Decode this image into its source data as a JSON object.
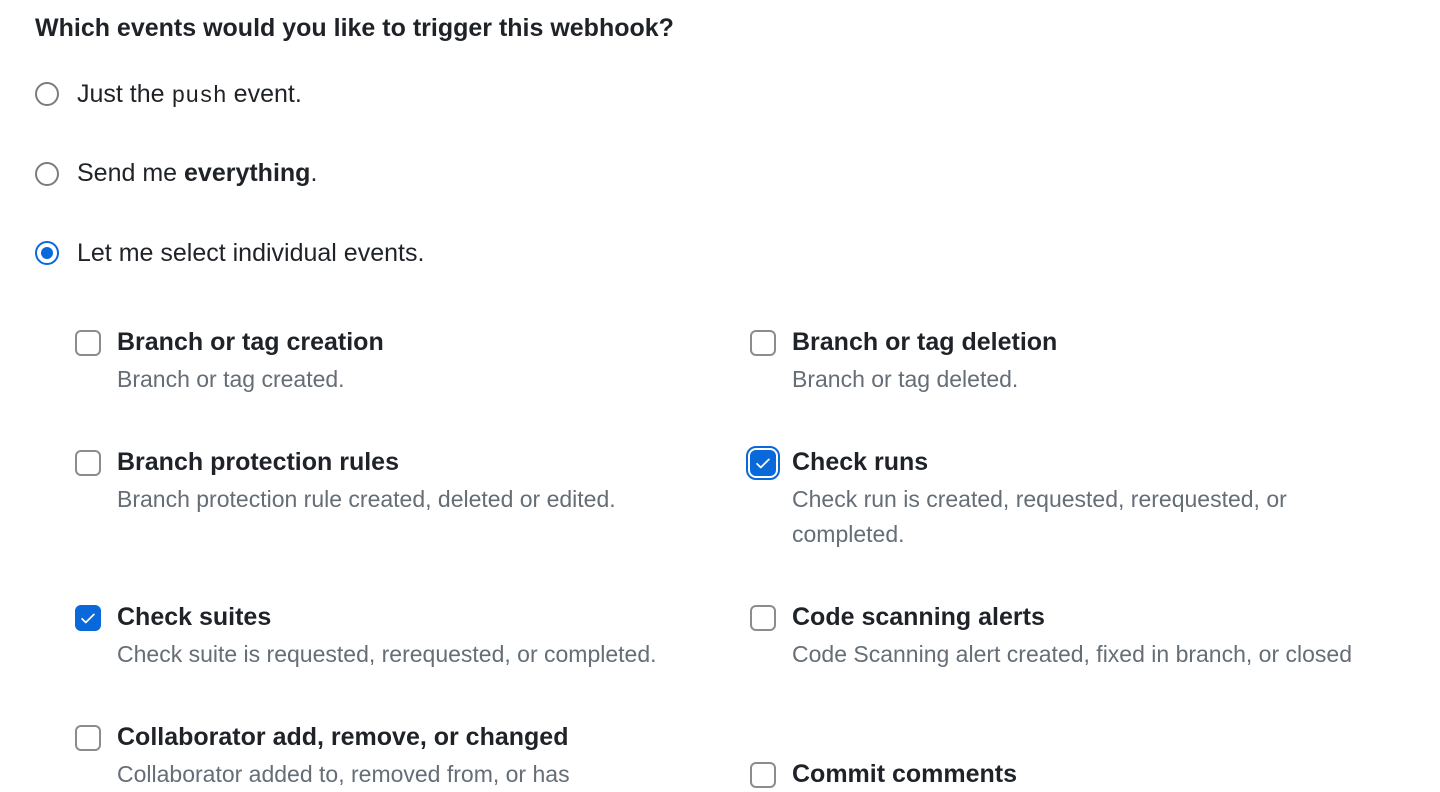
{
  "heading": "Which events would you like to trigger this webhook?",
  "radios": {
    "push": {
      "prefix": "Just the ",
      "code": "push",
      "suffix": " event.",
      "checked": false
    },
    "everything": {
      "prefix": "Send me ",
      "bold": "everything",
      "suffix": ".",
      "checked": false
    },
    "individual": {
      "text": "Let me select individual events.",
      "checked": true
    }
  },
  "events": {
    "branch_tag_creation": {
      "title": "Branch or tag creation",
      "desc": "Branch or tag created.",
      "checked": false
    },
    "branch_tag_deletion": {
      "title": "Branch or tag deletion",
      "desc": "Branch or tag deleted.",
      "checked": false
    },
    "branch_protection_rules": {
      "title": "Branch protection rules",
      "desc": "Branch protection rule created, deleted or edited.",
      "checked": false
    },
    "check_runs": {
      "title": "Check runs",
      "desc": "Check run is created, requested, rerequested, or completed.",
      "checked": true
    },
    "check_suites": {
      "title": "Check suites",
      "desc": "Check suite is requested, rerequested, or completed.",
      "checked": true
    },
    "code_scanning_alerts": {
      "title": "Code scanning alerts",
      "desc": "Code Scanning alert created, fixed in branch, or closed",
      "checked": false
    },
    "collaborator": {
      "title": "Collaborator add, remove, or changed",
      "desc": "Collaborator added to, removed from, or has",
      "checked": false
    },
    "commit_comments": {
      "title": "Commit comments",
      "desc": "",
      "checked": false
    }
  }
}
